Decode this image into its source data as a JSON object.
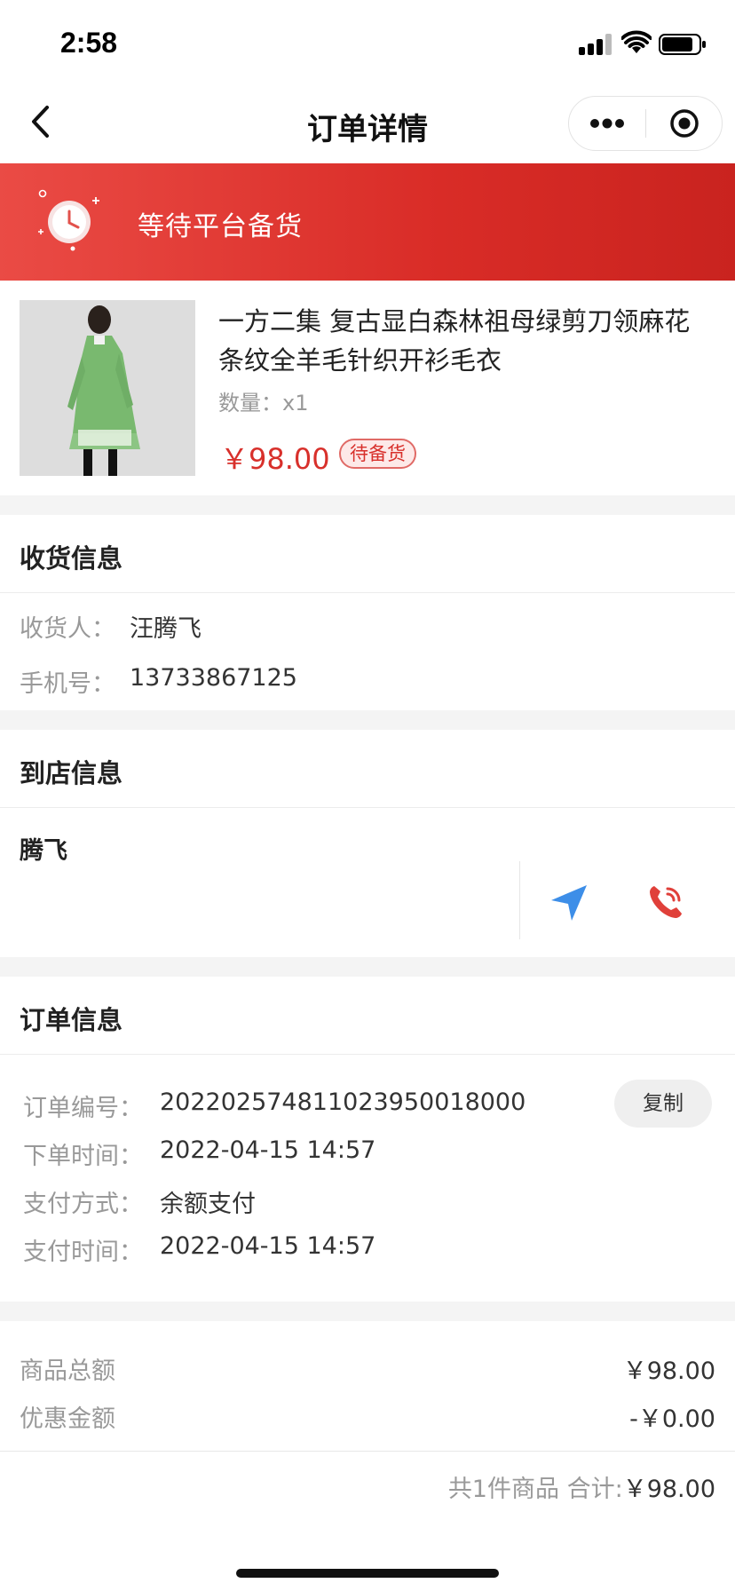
{
  "status_bar": {
    "time": "2:58"
  },
  "nav": {
    "title": "订单详情"
  },
  "banner": {
    "status_text": "等待平台备货"
  },
  "product": {
    "title": "一方二集 复古显白森林祖母绿剪刀领麻花条纹全羊毛针织开衫毛衣",
    "qty_label": "数量：",
    "qty_value": "x1",
    "price": "￥98.00",
    "badge": "待备货"
  },
  "receiver": {
    "title": "收货信息",
    "name_label": "收货人：",
    "name_value": "汪腾飞",
    "phone_label": "手机号：",
    "phone_value": "13733867125"
  },
  "store": {
    "title": "到店信息",
    "name": "腾飞"
  },
  "order": {
    "title": "订单信息",
    "rows": [
      {
        "label": "订单编号：",
        "value": "2022025748110239500180​00"
      },
      {
        "label": "下单时间：",
        "value": "2022-04-15 14:57"
      },
      {
        "label": "支付方式：",
        "value": "余额支付"
      },
      {
        "label": "支付时间：",
        "value": "2022-04-15 14:57"
      }
    ],
    "copy_label": "复制"
  },
  "summary": {
    "goods_total_label": "商品总额",
    "goods_total_value": "￥98.00",
    "discount_label": "优惠金额",
    "discount_value": "-￥0.00"
  },
  "footer": {
    "count_text": "共1件商品",
    "total_label": "合计:",
    "total_value": "￥98.00"
  },
  "colors": {
    "accent": "#d8302b",
    "banner_start": "#ea4b45",
    "banner_end": "#c9231f",
    "nav_icon": "#3d8ee8"
  }
}
